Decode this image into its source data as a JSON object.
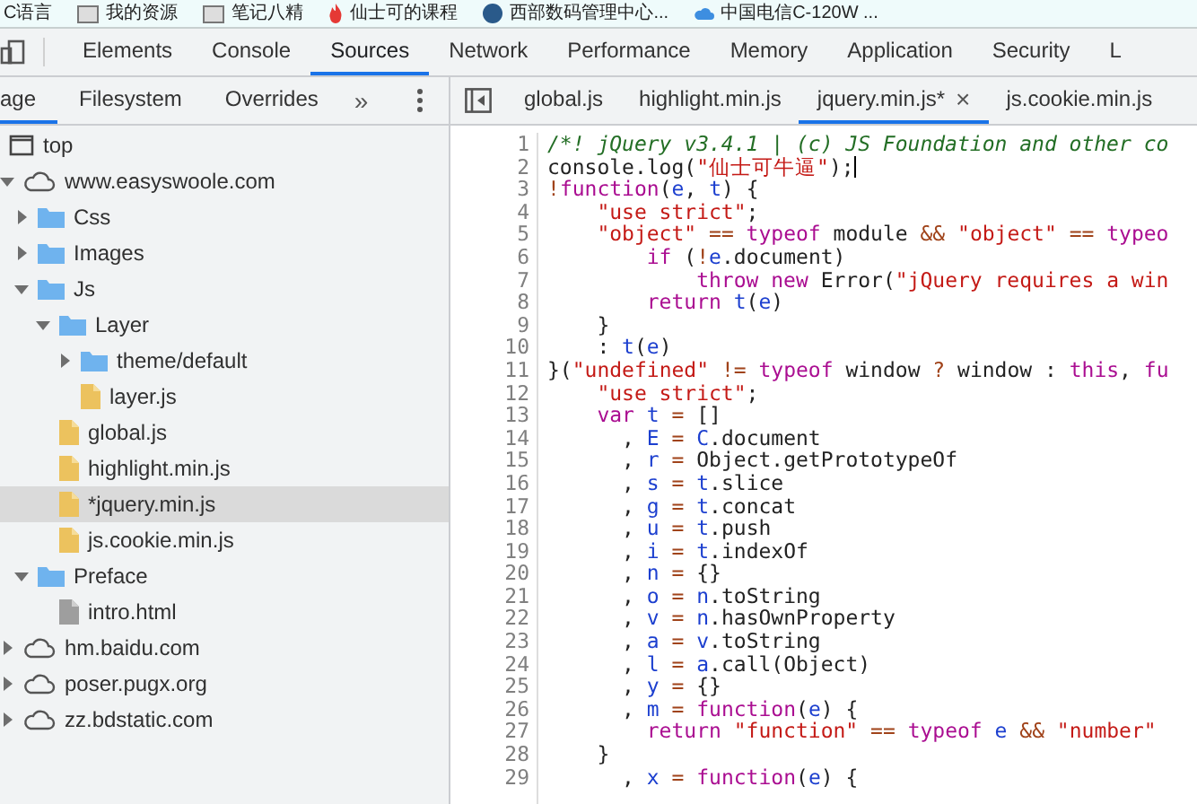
{
  "bookmarks": [
    {
      "label": "C语言",
      "kind": "plain"
    },
    {
      "label": "我的资源",
      "kind": "folder"
    },
    {
      "label": "笔记八精",
      "kind": "folder"
    },
    {
      "label": "仙士可的课程",
      "kind": "flame"
    },
    {
      "label": "西部数码管理中心...",
      "kind": "globe"
    },
    {
      "label": "中国电信C-120W ...",
      "kind": "cloud"
    }
  ],
  "devtools_tabs": [
    {
      "label": "Elements",
      "selected": false
    },
    {
      "label": "Console",
      "selected": false
    },
    {
      "label": "Sources",
      "selected": true
    },
    {
      "label": "Network",
      "selected": false
    },
    {
      "label": "Performance",
      "selected": false
    },
    {
      "label": "Memory",
      "selected": false
    },
    {
      "label": "Application",
      "selected": false
    },
    {
      "label": "Security",
      "selected": false
    },
    {
      "label": "L",
      "selected": false
    }
  ],
  "navigator": {
    "tabs": [
      {
        "label": "age",
        "selected": true
      },
      {
        "label": "Filesystem",
        "selected": false
      },
      {
        "label": "Overrides",
        "selected": false
      }
    ],
    "more": "»",
    "tree": [
      {
        "kind": "frame",
        "label": "top",
        "selected": false
      },
      {
        "kind": "domain",
        "label": "www.easyswoole.com",
        "expanded": true,
        "selected": false,
        "children": [
          {
            "kind": "folder",
            "label": "Css",
            "expanded": false,
            "selected": false
          },
          {
            "kind": "folder",
            "label": "Images",
            "expanded": false,
            "selected": false
          },
          {
            "kind": "folder",
            "label": "Js",
            "expanded": true,
            "selected": false,
            "children": [
              {
                "kind": "folder",
                "label": "Layer",
                "expanded": true,
                "selected": false,
                "children": [
                  {
                    "kind": "folder",
                    "label": "theme/default",
                    "expanded": false,
                    "selected": false
                  },
                  {
                    "kind": "script",
                    "label": "layer.js",
                    "selected": false
                  }
                ]
              },
              {
                "kind": "script",
                "label": "global.js",
                "selected": false
              },
              {
                "kind": "script",
                "label": "highlight.min.js",
                "selected": false
              },
              {
                "kind": "script",
                "label": "*jquery.min.js",
                "selected": true
              },
              {
                "kind": "script",
                "label": "js.cookie.min.js",
                "selected": false
              }
            ]
          },
          {
            "kind": "folder",
            "label": "Preface",
            "expanded": true,
            "selected": false,
            "children": [
              {
                "kind": "document",
                "label": "intro.html",
                "selected": false
              }
            ]
          }
        ]
      },
      {
        "kind": "domain",
        "label": "hm.baidu.com",
        "expanded": false,
        "selected": false
      },
      {
        "kind": "domain",
        "label": "poser.pugx.org",
        "expanded": false,
        "selected": false
      },
      {
        "kind": "domain",
        "label": "zz.bdstatic.com",
        "expanded": false,
        "selected": false
      }
    ]
  },
  "editor": {
    "tabs": [
      {
        "label": "global.js",
        "selected": false
      },
      {
        "label": "highlight.min.js",
        "selected": false
      },
      {
        "label": "jquery.min.js*",
        "selected": true,
        "close": "×"
      },
      {
        "label": "js.cookie.min.js",
        "selected": false
      }
    ],
    "lines": [
      {
        "number": "1",
        "segments": [
          {
            "kind": "comment",
            "text": "/*! jQuery v3.4.1 | (c) JS Foundation and other co"
          }
        ]
      },
      {
        "number": "2",
        "cursor": true,
        "segments": [
          {
            "kind": "plain",
            "text": "console.log("
          },
          {
            "kind": "string",
            "text": "\"仙士可牛逼\""
          },
          {
            "kind": "plain",
            "text": ");"
          }
        ]
      },
      {
        "number": "3",
        "segments": [
          {
            "kind": "operator",
            "text": "!"
          },
          {
            "kind": "keyword",
            "text": "function"
          },
          {
            "kind": "plain",
            "text": "("
          },
          {
            "kind": "variable",
            "text": "e"
          },
          {
            "kind": "plain",
            "text": ", "
          },
          {
            "kind": "variable",
            "text": "t"
          },
          {
            "kind": "plain",
            "text": ") {"
          }
        ]
      },
      {
        "number": "4",
        "segments": [
          {
            "kind": "string",
            "text": "    \"use strict\""
          },
          {
            "kind": "plain",
            "text": ";"
          }
        ]
      },
      {
        "number": "5",
        "segments": [
          {
            "kind": "string",
            "text": "    \"object\" "
          },
          {
            "kind": "operator",
            "text": "== "
          },
          {
            "kind": "keyword",
            "text": "typeof"
          },
          {
            "kind": "plain",
            "text": " module "
          },
          {
            "kind": "operator",
            "text": "&& "
          },
          {
            "kind": "string",
            "text": "\"object\" "
          },
          {
            "kind": "operator",
            "text": "== "
          },
          {
            "kind": "keyword",
            "text": "typeo"
          }
        ]
      },
      {
        "number": "6",
        "segments": [
          {
            "kind": "keyword",
            "text": "        if"
          },
          {
            "kind": "plain",
            "text": " ("
          },
          {
            "kind": "operator",
            "text": "!"
          },
          {
            "kind": "variable",
            "text": "e"
          },
          {
            "kind": "plain",
            "text": ".document)"
          }
        ]
      },
      {
        "number": "7",
        "segments": [
          {
            "kind": "keyword",
            "text": "            throw new"
          },
          {
            "kind": "plain",
            "text": " Error("
          },
          {
            "kind": "string",
            "text": "\"jQuery requires a win"
          }
        ]
      },
      {
        "number": "8",
        "segments": [
          {
            "kind": "keyword",
            "text": "        return "
          },
          {
            "kind": "variable",
            "text": "t"
          },
          {
            "kind": "plain",
            "text": "("
          },
          {
            "kind": "variable",
            "text": "e"
          },
          {
            "kind": "plain",
            "text": ")"
          }
        ]
      },
      {
        "number": "9",
        "segments": [
          {
            "kind": "plain",
            "text": "    }"
          }
        ]
      },
      {
        "number": "10",
        "segments": [
          {
            "kind": "plain",
            "text": "    : "
          },
          {
            "kind": "variable",
            "text": "t"
          },
          {
            "kind": "plain",
            "text": "("
          },
          {
            "kind": "variable",
            "text": "e"
          },
          {
            "kind": "plain",
            "text": ")"
          }
        ]
      },
      {
        "number": "11",
        "segments": [
          {
            "kind": "plain",
            "text": "}("
          },
          {
            "kind": "string",
            "text": "\"undefined\" "
          },
          {
            "kind": "operator",
            "text": "!= "
          },
          {
            "kind": "keyword",
            "text": "typeof"
          },
          {
            "kind": "plain",
            "text": " window "
          },
          {
            "kind": "operator",
            "text": "? "
          },
          {
            "kind": "plain",
            "text": "window : "
          },
          {
            "kind": "keyword",
            "text": "this"
          },
          {
            "kind": "plain",
            "text": ", "
          },
          {
            "kind": "keyword",
            "text": "fu"
          }
        ]
      },
      {
        "number": "12",
        "segments": [
          {
            "kind": "string",
            "text": "    \"use strict\""
          },
          {
            "kind": "plain",
            "text": ";"
          }
        ]
      },
      {
        "number": "13",
        "segments": [
          {
            "kind": "keyword",
            "text": "    var "
          },
          {
            "kind": "variable",
            "text": "t "
          },
          {
            "kind": "operator",
            "text": "= "
          },
          {
            "kind": "plain",
            "text": "[]"
          }
        ]
      },
      {
        "number": "14",
        "segments": [
          {
            "kind": "plain",
            "text": "      , "
          },
          {
            "kind": "variable",
            "text": "E "
          },
          {
            "kind": "operator",
            "text": "= "
          },
          {
            "kind": "variable",
            "text": "C"
          },
          {
            "kind": "plain",
            "text": ".document"
          }
        ]
      },
      {
        "number": "15",
        "segments": [
          {
            "kind": "plain",
            "text": "      , "
          },
          {
            "kind": "variable",
            "text": "r "
          },
          {
            "kind": "operator",
            "text": "= "
          },
          {
            "kind": "plain",
            "text": "Object.getPrototypeOf"
          }
        ]
      },
      {
        "number": "16",
        "segments": [
          {
            "kind": "plain",
            "text": "      , "
          },
          {
            "kind": "variable",
            "text": "s "
          },
          {
            "kind": "operator",
            "text": "= "
          },
          {
            "kind": "variable",
            "text": "t"
          },
          {
            "kind": "plain",
            "text": ".slice"
          }
        ]
      },
      {
        "number": "17",
        "segments": [
          {
            "kind": "plain",
            "text": "      , "
          },
          {
            "kind": "variable",
            "text": "g "
          },
          {
            "kind": "operator",
            "text": "= "
          },
          {
            "kind": "variable",
            "text": "t"
          },
          {
            "kind": "plain",
            "text": ".concat"
          }
        ]
      },
      {
        "number": "18",
        "segments": [
          {
            "kind": "plain",
            "text": "      , "
          },
          {
            "kind": "variable",
            "text": "u "
          },
          {
            "kind": "operator",
            "text": "= "
          },
          {
            "kind": "variable",
            "text": "t"
          },
          {
            "kind": "plain",
            "text": ".push"
          }
        ]
      },
      {
        "number": "19",
        "segments": [
          {
            "kind": "plain",
            "text": "      , "
          },
          {
            "kind": "variable",
            "text": "i "
          },
          {
            "kind": "operator",
            "text": "= "
          },
          {
            "kind": "variable",
            "text": "t"
          },
          {
            "kind": "plain",
            "text": ".indexOf"
          }
        ]
      },
      {
        "number": "20",
        "segments": [
          {
            "kind": "plain",
            "text": "      , "
          },
          {
            "kind": "variable",
            "text": "n "
          },
          {
            "kind": "operator",
            "text": "= "
          },
          {
            "kind": "plain",
            "text": "{}"
          }
        ]
      },
      {
        "number": "21",
        "segments": [
          {
            "kind": "plain",
            "text": "      , "
          },
          {
            "kind": "variable",
            "text": "o "
          },
          {
            "kind": "operator",
            "text": "= "
          },
          {
            "kind": "variable",
            "text": "n"
          },
          {
            "kind": "plain",
            "text": ".toString"
          }
        ]
      },
      {
        "number": "22",
        "segments": [
          {
            "kind": "plain",
            "text": "      , "
          },
          {
            "kind": "variable",
            "text": "v "
          },
          {
            "kind": "operator",
            "text": "= "
          },
          {
            "kind": "variable",
            "text": "n"
          },
          {
            "kind": "plain",
            "text": ".hasOwnProperty"
          }
        ]
      },
      {
        "number": "23",
        "segments": [
          {
            "kind": "plain",
            "text": "      , "
          },
          {
            "kind": "variable",
            "text": "a "
          },
          {
            "kind": "operator",
            "text": "= "
          },
          {
            "kind": "variable",
            "text": "v"
          },
          {
            "kind": "plain",
            "text": ".toString"
          }
        ]
      },
      {
        "number": "24",
        "segments": [
          {
            "kind": "plain",
            "text": "      , "
          },
          {
            "kind": "variable",
            "text": "l "
          },
          {
            "kind": "operator",
            "text": "= "
          },
          {
            "kind": "variable",
            "text": "a"
          },
          {
            "kind": "plain",
            "text": ".call(Object)"
          }
        ]
      },
      {
        "number": "25",
        "segments": [
          {
            "kind": "plain",
            "text": "      , "
          },
          {
            "kind": "variable",
            "text": "y "
          },
          {
            "kind": "operator",
            "text": "= "
          },
          {
            "kind": "plain",
            "text": "{}"
          }
        ]
      },
      {
        "number": "26",
        "segments": [
          {
            "kind": "plain",
            "text": "      , "
          },
          {
            "kind": "variable",
            "text": "m "
          },
          {
            "kind": "operator",
            "text": "= "
          },
          {
            "kind": "keyword",
            "text": "function"
          },
          {
            "kind": "plain",
            "text": "("
          },
          {
            "kind": "variable",
            "text": "e"
          },
          {
            "kind": "plain",
            "text": ") {"
          }
        ]
      },
      {
        "number": "27",
        "segments": [
          {
            "kind": "keyword",
            "text": "        return "
          },
          {
            "kind": "string",
            "text": "\"function\" "
          },
          {
            "kind": "operator",
            "text": "== "
          },
          {
            "kind": "keyword",
            "text": "typeof "
          },
          {
            "kind": "variable",
            "text": "e "
          },
          {
            "kind": "operator",
            "text": "&& "
          },
          {
            "kind": "string",
            "text": "\"number\""
          }
        ]
      },
      {
        "number": "28",
        "segments": [
          {
            "kind": "plain",
            "text": "    }"
          }
        ]
      },
      {
        "number": "29",
        "segments": [
          {
            "kind": "plain",
            "text": "      , "
          },
          {
            "kind": "variable",
            "text": "x "
          },
          {
            "kind": "operator",
            "text": "= "
          },
          {
            "kind": "keyword",
            "text": "function"
          },
          {
            "kind": "plain",
            "text": "("
          },
          {
            "kind": "variable",
            "text": "e"
          },
          {
            "kind": "plain",
            "text": ") {"
          }
        ]
      }
    ]
  }
}
